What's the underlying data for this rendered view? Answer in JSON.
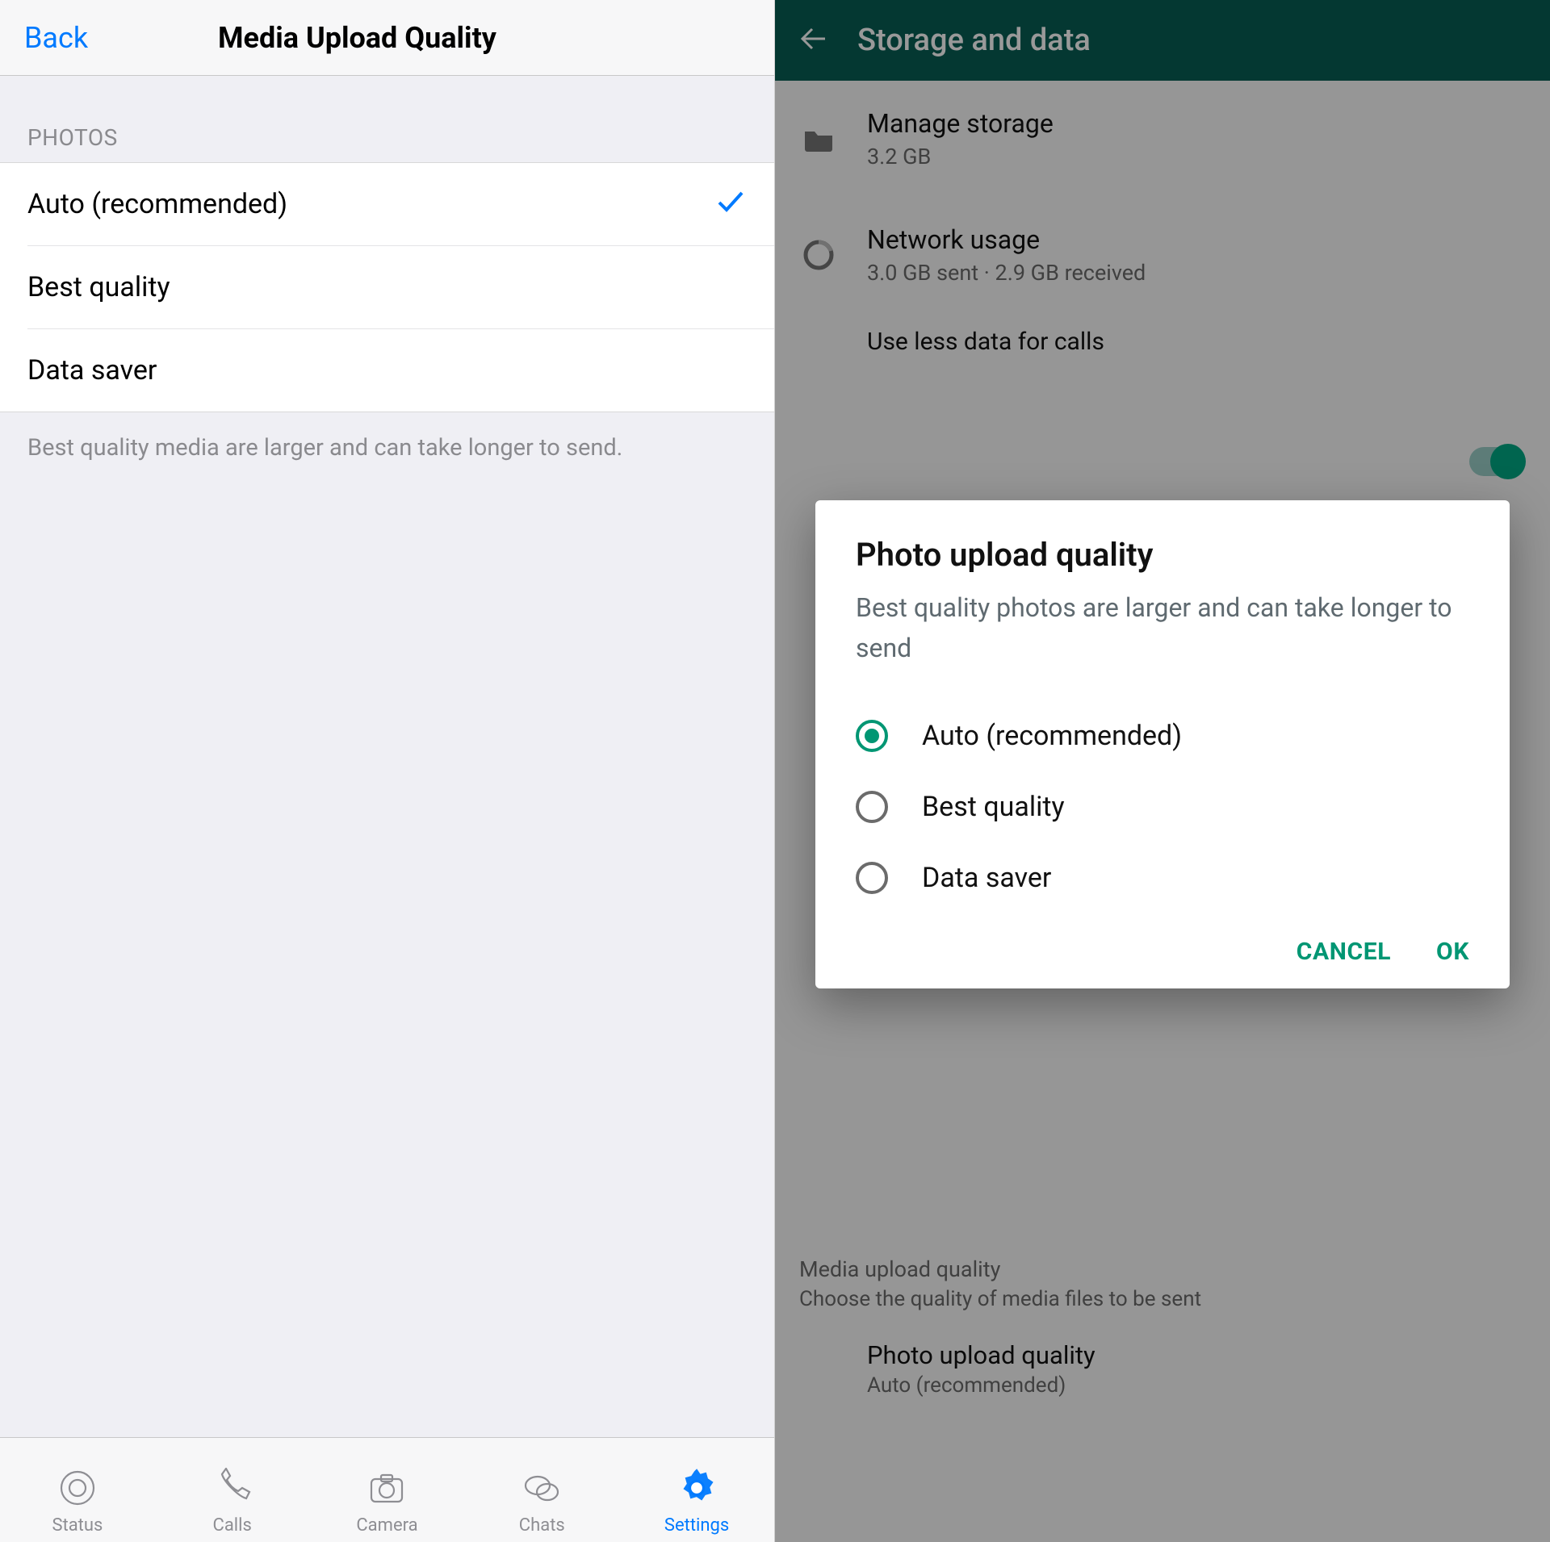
{
  "ios": {
    "nav": {
      "back_label": "Back",
      "title": "Media Upload Quality"
    },
    "section_header": "PHOTOS",
    "options": [
      {
        "label": "Auto (recommended)",
        "selected": true
      },
      {
        "label": "Best quality",
        "selected": false
      },
      {
        "label": "Data saver",
        "selected": false
      }
    ],
    "footer_note": "Best quality media are larger and can take longer to send.",
    "tabs": [
      {
        "label": "Status",
        "icon": "status-icon"
      },
      {
        "label": "Calls",
        "icon": "calls-icon"
      },
      {
        "label": "Camera",
        "icon": "camera-icon"
      },
      {
        "label": "Chats",
        "icon": "chats-icon"
      },
      {
        "label": "Settings",
        "icon": "settings-icon",
        "active": true
      }
    ]
  },
  "android": {
    "appbar_title": "Storage and data",
    "items": {
      "manage_storage": {
        "title": "Manage storage",
        "subtitle": "3.2 GB"
      },
      "network_usage": {
        "title": "Network usage",
        "subtitle": "3.0 GB sent · 2.9 GB received"
      },
      "peek_row": "Use less data for calls"
    },
    "section": {
      "label": "Media upload quality",
      "sub": "Choose the quality of media files to be sent",
      "photo": {
        "title": "Photo upload quality",
        "value": "Auto (recommended)"
      }
    },
    "dialog": {
      "title": "Photo upload quality",
      "desc": "Best quality photos are larger and can take longer to send",
      "options": [
        {
          "label": "Auto (recommended)",
          "selected": true
        },
        {
          "label": "Best quality",
          "selected": false
        },
        {
          "label": "Data saver",
          "selected": false
        }
      ],
      "cancel": "CANCEL",
      "ok": "OK"
    }
  }
}
